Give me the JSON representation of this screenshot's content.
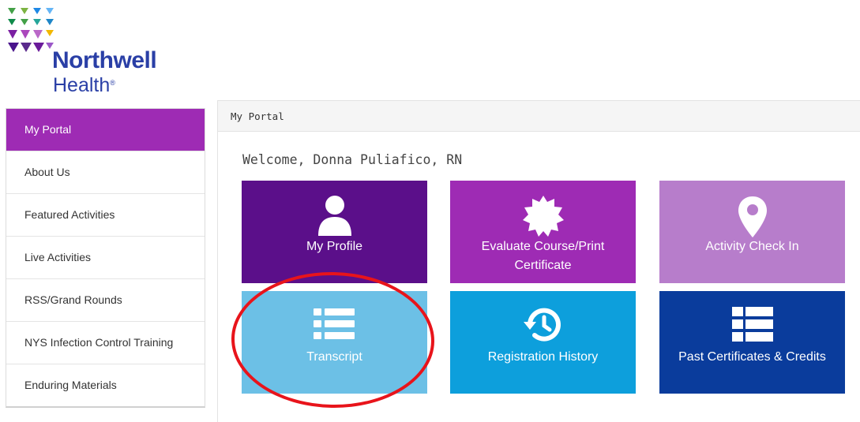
{
  "brand": {
    "name": "Northwell",
    "sub": "Health",
    "registered": "®",
    "colors": {
      "primary": "#2a3fa6",
      "green": "#0f8a4a",
      "purple": "#5a2a8c",
      "violet": "#9b57c8",
      "yellow": "#f2b700",
      "blue": "#1f86c7"
    }
  },
  "sidebar": {
    "items": [
      {
        "label": "My Portal",
        "active": true
      },
      {
        "label": "About Us"
      },
      {
        "label": "Featured Activities"
      },
      {
        "label": "Live Activities"
      },
      {
        "label": "RSS/Grand Rounds"
      },
      {
        "label": "NYS Infection Control Training"
      },
      {
        "label": "Enduring Materials"
      }
    ]
  },
  "main": {
    "panel_title": "My Portal",
    "welcome": "Welcome, Donna Puliafico, RN",
    "tiles": [
      {
        "label": "My Profile",
        "icon": "person-icon",
        "color": "#5b0f8a"
      },
      {
        "label": "Evaluate Course/Print Certificate",
        "icon": "certificate-seal-icon",
        "color": "#9e2bb4"
      },
      {
        "label": "Activity Check In",
        "icon": "map-pin-icon",
        "color": "#b77dcb"
      },
      {
        "label": "Transcript",
        "icon": "list-icon",
        "color": "#6cc0e6"
      },
      {
        "label": "Registration History",
        "icon": "history-icon",
        "color": "#0d9fdc"
      },
      {
        "label": "Past Certificates & Credits",
        "icon": "table-list-icon",
        "color": "#0a3c9c"
      }
    ]
  },
  "annotation": {
    "color": "#e8141b",
    "target": "Transcript"
  }
}
